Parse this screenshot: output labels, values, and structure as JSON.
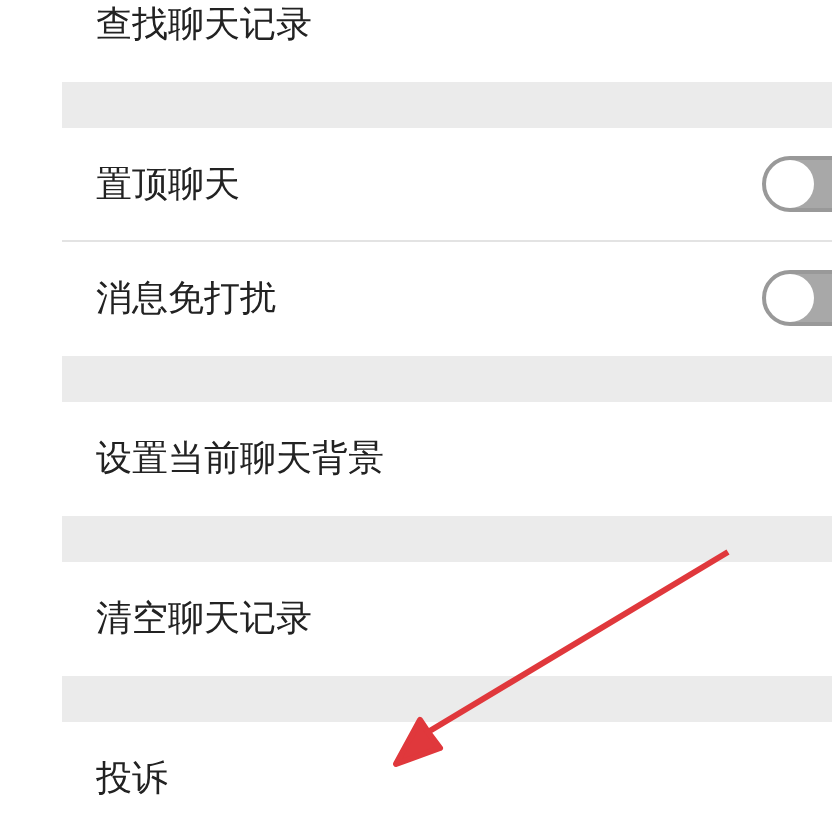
{
  "groups": [
    {
      "items": [
        {
          "kind": "link",
          "label": "查找聊天记录"
        }
      ]
    },
    {
      "items": [
        {
          "kind": "toggle",
          "label": "置顶聊天",
          "on": false
        },
        {
          "kind": "toggle",
          "label": "消息免打扰",
          "on": false
        }
      ]
    },
    {
      "items": [
        {
          "kind": "link",
          "label": "设置当前聊天背景"
        }
      ]
    },
    {
      "items": [
        {
          "kind": "link",
          "label": "清空聊天记录"
        }
      ]
    },
    {
      "items": [
        {
          "kind": "link",
          "label": "投诉"
        }
      ]
    }
  ]
}
